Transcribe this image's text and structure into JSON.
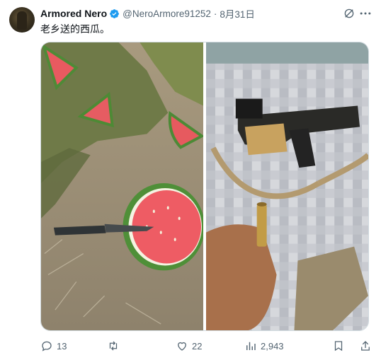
{
  "tweet": {
    "display_name": "Armored Nero",
    "handle": "@NeroArmore91252",
    "separator": "·",
    "date": "8月31日",
    "text": "老乡送的西瓜。"
  },
  "media": {
    "photos": [
      {
        "subject": "watermelon slices and knife on dirt ground"
      },
      {
        "subject": "rifle with sling on blanket, hand holding cartridge"
      }
    ]
  },
  "actions": {
    "reply_count": "13",
    "retweet_count": "",
    "like_count": "22",
    "view_count": "2,943"
  },
  "colors": {
    "text_primary": "#0f1419",
    "text_secondary": "#536471",
    "verified_blue": "#1d9bf0"
  },
  "icons": [
    "verified-badge-icon",
    "grok-icon",
    "more-icon",
    "reply-icon",
    "retweet-icon",
    "like-icon",
    "views-icon",
    "bookmark-icon",
    "share-icon"
  ]
}
